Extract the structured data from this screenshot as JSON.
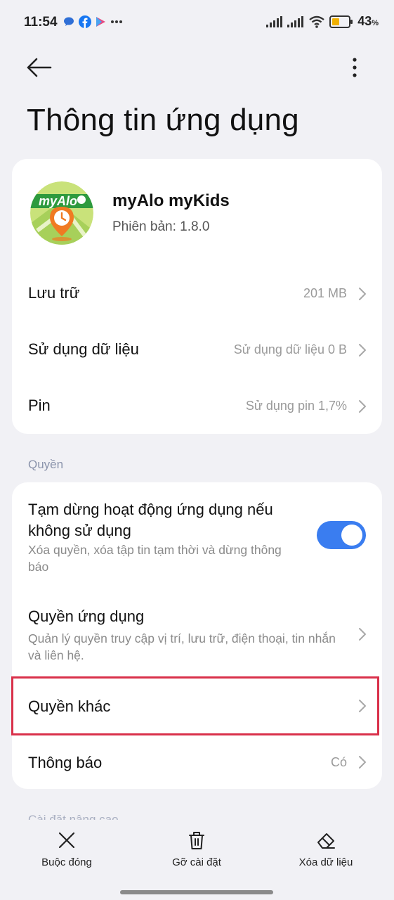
{
  "status_bar": {
    "time": "11:54",
    "battery_percent": "43",
    "battery_unit": "%",
    "notification_icons": [
      "chat-bubble-icon",
      "facebook-icon",
      "play-store-icon",
      "more-dots-icon"
    ],
    "system_icons": [
      "signal-icon",
      "signal-icon",
      "wifi-icon",
      "battery-icon"
    ]
  },
  "header": {
    "title": "Thông tin ứng dụng",
    "back_icon": "arrow-left-icon",
    "menu_icon": "more-vertical-icon"
  },
  "app": {
    "name": "myAlo myKids",
    "version": "Phiên bản: 1.8.0",
    "icon_text": "myAlo",
    "icon": "myalo-app-icon"
  },
  "info_rows": [
    {
      "label": "Lưu trữ",
      "value": "201 MB"
    },
    {
      "label": "Sử dụng dữ liệu",
      "value": "Sử dụng dữ liệu 0 B"
    },
    {
      "label": "Pin",
      "value": "Sử dụng pin 1,7%"
    }
  ],
  "permissions": {
    "section_label": "Quyền",
    "pause": {
      "title": "Tạm dừng hoạt động ứng dụng nếu không sử dụng",
      "description": "Xóa quyền, xóa tập tin tạm thời và dừng thông báo",
      "enabled": true
    },
    "app_permissions": {
      "title": "Quyền ứng dụng",
      "description": "Quản lý quyền truy cập vị trí, lưu trữ, điện thoại, tin nhắn và liên hệ."
    },
    "other_permissions": {
      "title": "Quyền khác"
    },
    "notifications": {
      "title": "Thông báo",
      "value": "Có"
    }
  },
  "next_section_label": "Cài đặt nâng cao",
  "bottom_actions": [
    {
      "label": "Buộc đóng",
      "icon": "close-icon"
    },
    {
      "label": "Gỡ cài đặt",
      "icon": "trash-icon"
    },
    {
      "label": "Xóa dữ liệu",
      "icon": "eraser-icon"
    }
  ],
  "colors": {
    "accent": "#3a7df0",
    "highlight_border": "#d9304a",
    "background": "#f1f1f5",
    "card": "#ffffff"
  }
}
